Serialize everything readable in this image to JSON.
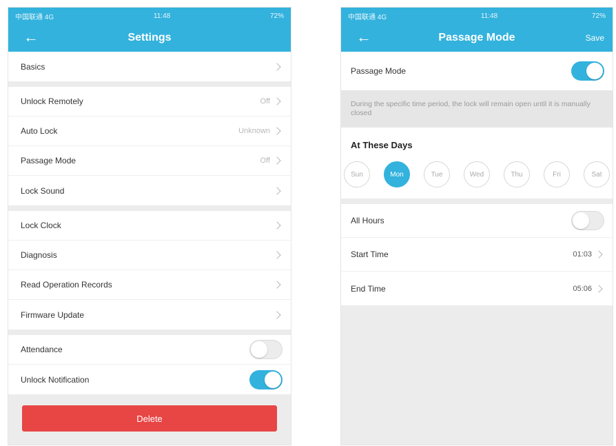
{
  "settings": {
    "status": {
      "carrier": "中国联通 4G",
      "time": "11:48",
      "battery": "72%"
    },
    "nav": {
      "title": "Settings",
      "back_icon": "arrow-left-icon"
    },
    "groups": [
      [
        {
          "label": "Basics",
          "value": ""
        }
      ],
      [
        {
          "label": "Unlock Remotely",
          "value": "Off"
        },
        {
          "label": "Auto Lock",
          "value": "Unknown"
        },
        {
          "label": "Passage Mode",
          "value": "Off"
        },
        {
          "label": "Lock Sound",
          "value": ""
        }
      ],
      [
        {
          "label": "Lock Clock",
          "value": ""
        },
        {
          "label": "Diagnosis",
          "value": ""
        },
        {
          "label": "Read Operation Records",
          "value": ""
        },
        {
          "label": "Firmware Update",
          "value": ""
        }
      ]
    ],
    "toggles": [
      {
        "label": "Attendance",
        "on": false
      },
      {
        "label": "Unlock Notification",
        "on": true
      }
    ],
    "delete_label": "Delete"
  },
  "passage": {
    "status": {
      "carrier": "中国联通 4G",
      "time": "11:48",
      "battery": "72%"
    },
    "nav": {
      "title": "Passage Mode",
      "save_label": "Save",
      "back_icon": "arrow-left-icon"
    },
    "mode_label": "Passage Mode",
    "mode_on": true,
    "description": "During the specific time period, the lock will remain open until it is manually closed",
    "days_title": "At These Days",
    "days": [
      {
        "label": "Sun",
        "selected": false
      },
      {
        "label": "Mon",
        "selected": true
      },
      {
        "label": "Tue",
        "selected": false
      },
      {
        "label": "Wed",
        "selected": false
      },
      {
        "label": "Thu",
        "selected": false
      },
      {
        "label": "Fri",
        "selected": false
      },
      {
        "label": "Sat",
        "selected": false
      }
    ],
    "all_hours_label": "All Hours",
    "all_hours_on": false,
    "start_time_label": "Start Time",
    "start_time": "01:03",
    "end_time_label": "End Time",
    "end_time": "05:06"
  },
  "colors": {
    "accent": "#33b2dd",
    "danger": "#e84545",
    "background": "#ececec"
  }
}
